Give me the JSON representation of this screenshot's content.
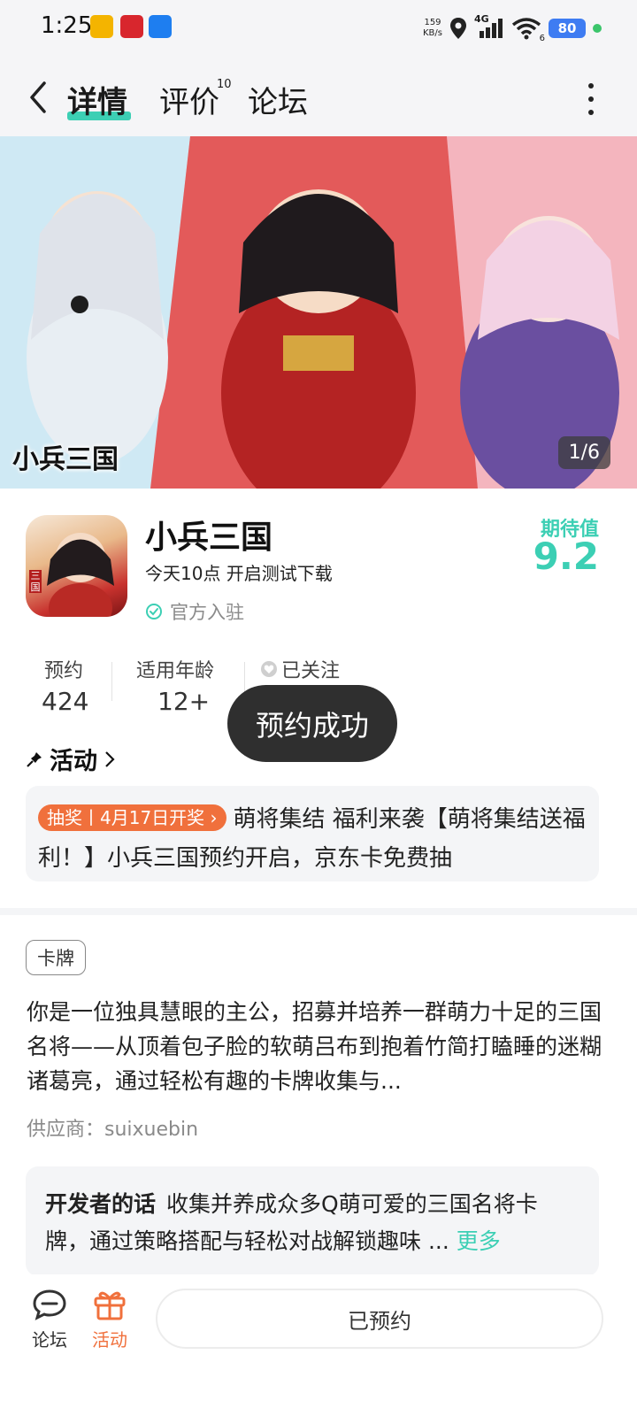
{
  "status_bar": {
    "time": "1:25",
    "net_speed_value": "159",
    "net_speed_unit": "KB/s",
    "network": "4G",
    "wifi_badge": "6",
    "battery": "80"
  },
  "header": {
    "tabs": [
      {
        "label": "详情",
        "active": true
      },
      {
        "label": "评价",
        "badge": "10"
      },
      {
        "label": "论坛"
      }
    ]
  },
  "banner": {
    "logo_text": "小兵三国",
    "counter": "1/6"
  },
  "app": {
    "name": "小兵三国",
    "subtitle": "今天10点 开启测试下载",
    "official_label": "官方入驻",
    "icon_badge": "三国",
    "score_label": "期待值",
    "score_value": "9.2"
  },
  "stats": {
    "reservations_label": "预约",
    "reservations_value": "424",
    "age_label": "适用年龄",
    "age_value": "12+",
    "follow_label": "已关注"
  },
  "toast": "预约成功",
  "activity": {
    "header": "活动",
    "tag": "抽奖丨4月17日开奖",
    "text": "萌将集结 福利来袭【萌将集结送福利！】小兵三国预约开启，京东卡免费抽"
  },
  "details": {
    "genre_tag": "卡牌",
    "description": "你是一位独具慧眼的主公，招募并培养一群萌力十足的三国名将——从顶着包子脸的软萌吕布到抱着竹简打瞌睡的迷糊诸葛亮，通过轻松有趣的卡牌收集与...",
    "supplier": "供应商：suixuebin",
    "dev_title": "开发者的话",
    "dev_text": "收集并养成众多Q萌可爱的三国名将卡牌，通过策略搭配与轻松对战解锁趣味 ...",
    "dev_more": "更多"
  },
  "bottom_bar": {
    "forum_label": "论坛",
    "activity_label": "活动",
    "reserved_button": "已预约"
  },
  "colors": {
    "accent_teal": "#3ccfb4",
    "accent_orange": "#f0703c",
    "toast_bg": "#2f2f2f"
  }
}
